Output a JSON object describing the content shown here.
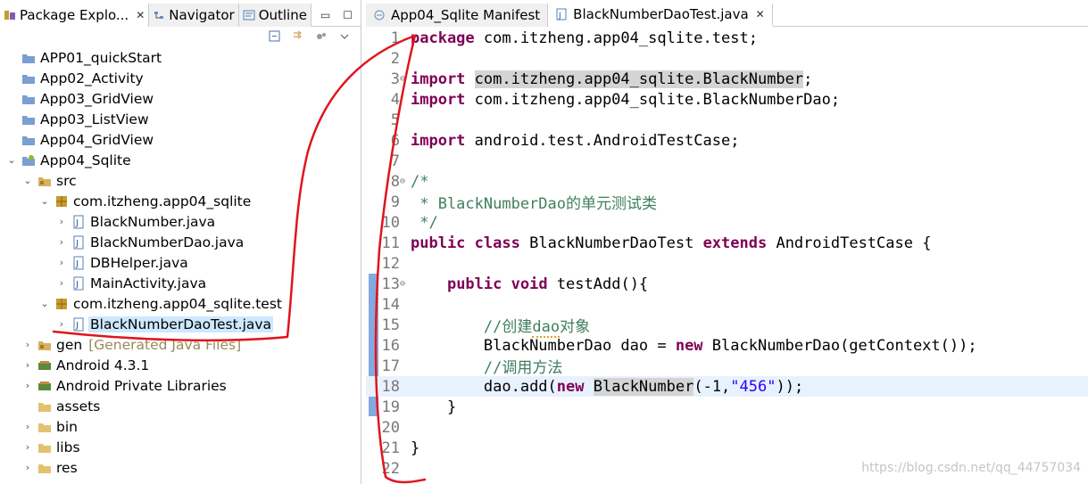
{
  "left_tabs": [
    {
      "label": "Package Explo...",
      "icon": "package-explorer-icon"
    },
    {
      "label": "Navigator",
      "icon": "navigator-icon"
    },
    {
      "label": "Outline",
      "icon": "outline-icon"
    }
  ],
  "tree": {
    "projects": [
      {
        "label": "APP01_quickStart"
      },
      {
        "label": "App02_Activity"
      },
      {
        "label": "App03_GridView"
      },
      {
        "label": "App03_ListView"
      },
      {
        "label": "App04_GridView"
      },
      {
        "label": "App04_Sqlite"
      }
    ],
    "src": "src",
    "pkg1": "com.itzheng.app04_sqlite",
    "pkg1_files": [
      "BlackNumber.java",
      "BlackNumberDao.java",
      "DBHelper.java",
      "MainActivity.java"
    ],
    "pkg2": "com.itzheng.app04_sqlite.test",
    "pkg2_file": "BlackNumberDaoTest.java",
    "gen": "gen",
    "gen_deco": "[Generated Java Files]",
    "android": "Android 4.3.1",
    "private_libs": "Android Private Libraries",
    "assets": "assets",
    "bin": "bin",
    "libs": "libs",
    "res": "res"
  },
  "editor_tabs": [
    {
      "label": "App04_Sqlite Manifest"
    },
    {
      "label": "BlackNumberDaoTest.java"
    }
  ],
  "code": {
    "line_numbers": [
      "1",
      "2",
      "3",
      "4",
      "5",
      "6",
      "7",
      "8",
      "9",
      "10",
      "11",
      "12",
      "13",
      "14",
      "15",
      "16",
      "17",
      "18",
      "19",
      "20",
      "21",
      "22"
    ],
    "l1_kw": "package",
    "l1_rest": " com.itzheng.app04_sqlite.test;",
    "l3_kw": "import",
    "l3_cls": "com.itzheng.app04_sqlite.BlackNumber",
    "l3_end": ";",
    "l4_kw": "import",
    "l4_rest": " com.itzheng.app04_sqlite.BlackNumberDao;",
    "l6_kw": "import",
    "l6_rest": " android.test.AndroidTestCase;",
    "l8": "/*",
    "l9": " * BlackNumberDao的单元测试类",
    "l10": " */",
    "l11_kw1": "public",
    "l11_kw2": "class",
    "l11_name": " BlackNumberDaoTest ",
    "l11_kw3": "extends",
    "l11_rest": " AndroidTestCase {",
    "l13_kw1": "public",
    "l13_kw2": "void",
    "l13_rest": " testAdd(){",
    "l15_pre": "//创建",
    "l15_dao": "dao",
    "l15_post": "对象",
    "l16_a": "BlackNumberDao dao = ",
    "l16_kw": "new",
    "l16_b": " BlackNumberDao(getContext());",
    "l17": "//调用方法",
    "l18_a": "dao.add(",
    "l18_kw": "new",
    "l18_cls": "BlackNumber",
    "l18_b": "(-1,",
    "l18_str": "\"456\"",
    "l18_c": "));",
    "l19": "}",
    "l21": "}"
  },
  "watermark": "https://blog.csdn.net/qq_44757034",
  "colors": {
    "keyword": "#7f0055",
    "comment": "#3f7f5f",
    "string": "#2a00ff",
    "annotation": "#e0141e",
    "selection": "#cde8ff"
  }
}
